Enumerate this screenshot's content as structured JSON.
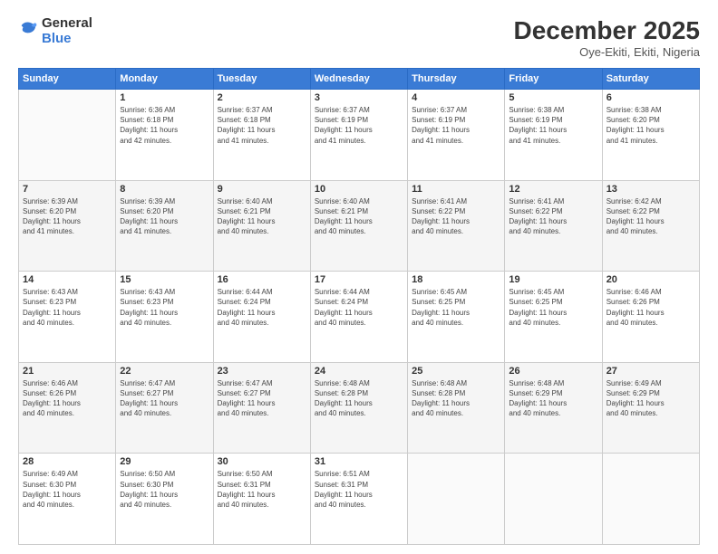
{
  "header": {
    "logo_general": "General",
    "logo_blue": "Blue",
    "month": "December 2025",
    "location": "Oye-Ekiti, Ekiti, Nigeria"
  },
  "days_of_week": [
    "Sunday",
    "Monday",
    "Tuesday",
    "Wednesday",
    "Thursday",
    "Friday",
    "Saturday"
  ],
  "weeks": [
    [
      {
        "day": "",
        "info": ""
      },
      {
        "day": "1",
        "info": "Sunrise: 6:36 AM\nSunset: 6:18 PM\nDaylight: 11 hours\nand 42 minutes."
      },
      {
        "day": "2",
        "info": "Sunrise: 6:37 AM\nSunset: 6:18 PM\nDaylight: 11 hours\nand 41 minutes."
      },
      {
        "day": "3",
        "info": "Sunrise: 6:37 AM\nSunset: 6:19 PM\nDaylight: 11 hours\nand 41 minutes."
      },
      {
        "day": "4",
        "info": "Sunrise: 6:37 AM\nSunset: 6:19 PM\nDaylight: 11 hours\nand 41 minutes."
      },
      {
        "day": "5",
        "info": "Sunrise: 6:38 AM\nSunset: 6:19 PM\nDaylight: 11 hours\nand 41 minutes."
      },
      {
        "day": "6",
        "info": "Sunrise: 6:38 AM\nSunset: 6:20 PM\nDaylight: 11 hours\nand 41 minutes."
      }
    ],
    [
      {
        "day": "7",
        "info": "Sunrise: 6:39 AM\nSunset: 6:20 PM\nDaylight: 11 hours\nand 41 minutes."
      },
      {
        "day": "8",
        "info": "Sunrise: 6:39 AM\nSunset: 6:20 PM\nDaylight: 11 hours\nand 41 minutes."
      },
      {
        "day": "9",
        "info": "Sunrise: 6:40 AM\nSunset: 6:21 PM\nDaylight: 11 hours\nand 40 minutes."
      },
      {
        "day": "10",
        "info": "Sunrise: 6:40 AM\nSunset: 6:21 PM\nDaylight: 11 hours\nand 40 minutes."
      },
      {
        "day": "11",
        "info": "Sunrise: 6:41 AM\nSunset: 6:22 PM\nDaylight: 11 hours\nand 40 minutes."
      },
      {
        "day": "12",
        "info": "Sunrise: 6:41 AM\nSunset: 6:22 PM\nDaylight: 11 hours\nand 40 minutes."
      },
      {
        "day": "13",
        "info": "Sunrise: 6:42 AM\nSunset: 6:22 PM\nDaylight: 11 hours\nand 40 minutes."
      }
    ],
    [
      {
        "day": "14",
        "info": "Sunrise: 6:43 AM\nSunset: 6:23 PM\nDaylight: 11 hours\nand 40 minutes."
      },
      {
        "day": "15",
        "info": "Sunrise: 6:43 AM\nSunset: 6:23 PM\nDaylight: 11 hours\nand 40 minutes."
      },
      {
        "day": "16",
        "info": "Sunrise: 6:44 AM\nSunset: 6:24 PM\nDaylight: 11 hours\nand 40 minutes."
      },
      {
        "day": "17",
        "info": "Sunrise: 6:44 AM\nSunset: 6:24 PM\nDaylight: 11 hours\nand 40 minutes."
      },
      {
        "day": "18",
        "info": "Sunrise: 6:45 AM\nSunset: 6:25 PM\nDaylight: 11 hours\nand 40 minutes."
      },
      {
        "day": "19",
        "info": "Sunrise: 6:45 AM\nSunset: 6:25 PM\nDaylight: 11 hours\nand 40 minutes."
      },
      {
        "day": "20",
        "info": "Sunrise: 6:46 AM\nSunset: 6:26 PM\nDaylight: 11 hours\nand 40 minutes."
      }
    ],
    [
      {
        "day": "21",
        "info": "Sunrise: 6:46 AM\nSunset: 6:26 PM\nDaylight: 11 hours\nand 40 minutes."
      },
      {
        "day": "22",
        "info": "Sunrise: 6:47 AM\nSunset: 6:27 PM\nDaylight: 11 hours\nand 40 minutes."
      },
      {
        "day": "23",
        "info": "Sunrise: 6:47 AM\nSunset: 6:27 PM\nDaylight: 11 hours\nand 40 minutes."
      },
      {
        "day": "24",
        "info": "Sunrise: 6:48 AM\nSunset: 6:28 PM\nDaylight: 11 hours\nand 40 minutes."
      },
      {
        "day": "25",
        "info": "Sunrise: 6:48 AM\nSunset: 6:28 PM\nDaylight: 11 hours\nand 40 minutes."
      },
      {
        "day": "26",
        "info": "Sunrise: 6:48 AM\nSunset: 6:29 PM\nDaylight: 11 hours\nand 40 minutes."
      },
      {
        "day": "27",
        "info": "Sunrise: 6:49 AM\nSunset: 6:29 PM\nDaylight: 11 hours\nand 40 minutes."
      }
    ],
    [
      {
        "day": "28",
        "info": "Sunrise: 6:49 AM\nSunset: 6:30 PM\nDaylight: 11 hours\nand 40 minutes."
      },
      {
        "day": "29",
        "info": "Sunrise: 6:50 AM\nSunset: 6:30 PM\nDaylight: 11 hours\nand 40 minutes."
      },
      {
        "day": "30",
        "info": "Sunrise: 6:50 AM\nSunset: 6:31 PM\nDaylight: 11 hours\nand 40 minutes."
      },
      {
        "day": "31",
        "info": "Sunrise: 6:51 AM\nSunset: 6:31 PM\nDaylight: 11 hours\nand 40 minutes."
      },
      {
        "day": "",
        "info": ""
      },
      {
        "day": "",
        "info": ""
      },
      {
        "day": "",
        "info": ""
      }
    ]
  ]
}
